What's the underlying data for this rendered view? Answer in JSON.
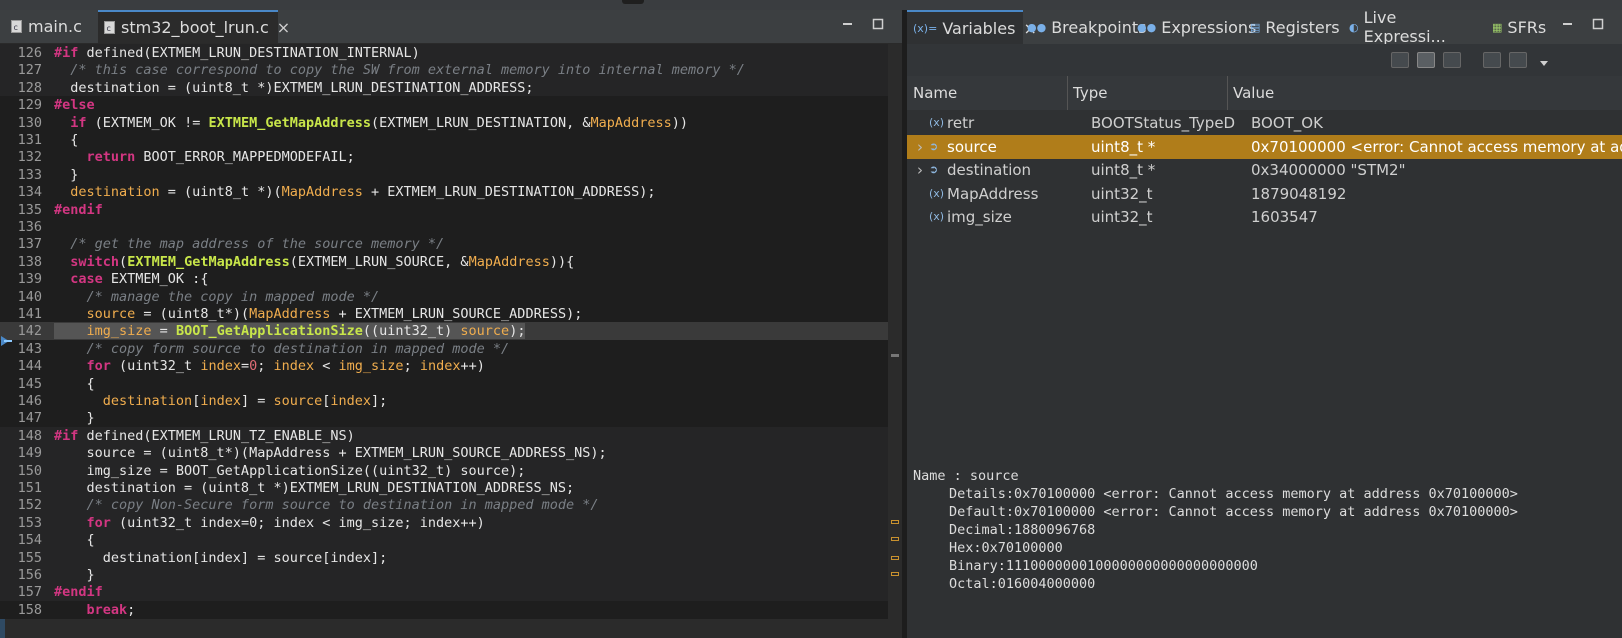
{
  "editor": {
    "tabs": [
      {
        "label": "main.c",
        "active": false
      },
      {
        "label": "stm32_boot_lrun.c",
        "active": true,
        "close": "×"
      }
    ],
    "current_line": 142,
    "lines": [
      {
        "n": "126",
        "t": "#if defined(EXTMEM_LRUN_DESTINATION_INTERNAL)"
      },
      {
        "n": "127",
        "t": "  /* this case correspond to copy the SW from external memory into internal memory */"
      },
      {
        "n": "128",
        "t": "  destination = (uint8_t *)EXTMEM_LRUN_DESTINATION_ADDRESS;"
      },
      {
        "n": "129",
        "t": "#else"
      },
      {
        "n": "130",
        "t": "  if (EXTMEM_OK != EXTMEM_GetMapAddress(EXTMEM_LRUN_DESTINATION, &MapAddress))"
      },
      {
        "n": "131",
        "t": "  {"
      },
      {
        "n": "132",
        "t": "    return BOOT_ERROR_MAPPEDMODEFAIL;"
      },
      {
        "n": "133",
        "t": "  }"
      },
      {
        "n": "134",
        "t": "  destination = (uint8_t *)(MapAddress + EXTMEM_LRUN_DESTINATION_ADDRESS);"
      },
      {
        "n": "135",
        "t": "#endif"
      },
      {
        "n": "136",
        "t": ""
      },
      {
        "n": "137",
        "t": "  /* get the map address of the source memory */"
      },
      {
        "n": "138",
        "t": "  switch(EXTMEM_GetMapAddress(EXTMEM_LRUN_SOURCE, &MapAddress)){"
      },
      {
        "n": "139",
        "t": "  case EXTMEM_OK :{"
      },
      {
        "n": "140",
        "t": "    /* manage the copy in mapped mode */"
      },
      {
        "n": "141",
        "t": "    source = (uint8_t*)(MapAddress + EXTMEM_LRUN_SOURCE_ADDRESS);"
      },
      {
        "n": "142",
        "t": "    img_size = BOOT_GetApplicationSize((uint32_t) source);"
      },
      {
        "n": "143",
        "t": "    /* copy form source to destination in mapped mode */"
      },
      {
        "n": "144",
        "t": "    for (uint32_t index=0; index < img_size; index++)"
      },
      {
        "n": "145",
        "t": "    {"
      },
      {
        "n": "146",
        "t": "      destination[index] = source[index];"
      },
      {
        "n": "147",
        "t": "    }"
      },
      {
        "n": "148",
        "t": "#if defined(EXTMEM_LRUN_TZ_ENABLE_NS)"
      },
      {
        "n": "149",
        "t": "    source = (uint8_t*)(MapAddress + EXTMEM_LRUN_SOURCE_ADDRESS_NS);"
      },
      {
        "n": "150",
        "t": "    img_size = BOOT_GetApplicationSize((uint32_t) source);"
      },
      {
        "n": "151",
        "t": "    destination = (uint8_t *)EXTMEM_LRUN_DESTINATION_ADDRESS_NS;"
      },
      {
        "n": "152",
        "t": "    /* copy Non-Secure form source to destination in mapped mode */"
      },
      {
        "n": "153",
        "t": "    for (uint32_t index=0; index < img_size; index++)"
      },
      {
        "n": "154",
        "t": "    {"
      },
      {
        "n": "155",
        "t": "      destination[index] = source[index];"
      },
      {
        "n": "156",
        "t": "    }"
      },
      {
        "n": "157",
        "t": "#endif"
      },
      {
        "n": "158",
        "t": "    break;"
      }
    ]
  },
  "views": {
    "tabs": [
      {
        "label": "Variables",
        "active": true,
        "close": "×",
        "icon": "variables-icon"
      },
      {
        "label": "Breakpoints",
        "active": false,
        "icon": "breakpoints-icon"
      },
      {
        "label": "Expressions",
        "active": false,
        "icon": "expressions-icon"
      },
      {
        "label": "Registers",
        "active": false,
        "icon": "registers-icon"
      },
      {
        "label": "Live Expressi...",
        "active": false,
        "icon": "live-expressions-icon"
      },
      {
        "label": "SFRs",
        "active": false,
        "icon": "sfrs-icon"
      }
    ],
    "columns": {
      "name": "Name",
      "type": "Type",
      "value": "Value"
    },
    "rows": [
      {
        "expandable": false,
        "name": "retr",
        "type": "BOOTStatus_TypeD",
        "value": "BOOT_OK",
        "selected": false
      },
      {
        "expandable": true,
        "name": "source",
        "type": "uint8_t *",
        "value": "0x70100000 <error: Cannot access memory at add",
        "selected": true
      },
      {
        "expandable": true,
        "name": "destination",
        "type": "uint8_t *",
        "value": "0x34000000 \"STM2\"",
        "selected": false
      },
      {
        "expandable": false,
        "name": "MapAddress",
        "type": "uint32_t",
        "value": "1879048192",
        "selected": false
      },
      {
        "expandable": false,
        "name": "img_size",
        "type": "uint32_t",
        "value": "1603547",
        "selected": false
      }
    ],
    "details": {
      "header": "Name : source",
      "lines": [
        "Details:0x70100000 <error: Cannot access memory at address 0x70100000>",
        "Default:0x70100000 <error: Cannot access memory at address 0x70100000>",
        "Decimal:1880096768",
        "Hex:0x70100000",
        "Binary:1110000000100000000000000000000",
        "Octal:016004000000"
      ]
    }
  },
  "colors": {
    "selected_row": "#b07d1a",
    "keyword": "#d33682",
    "function": "#c8e64a",
    "variable": "#f0ad4e",
    "comment": "#7a7f85"
  }
}
